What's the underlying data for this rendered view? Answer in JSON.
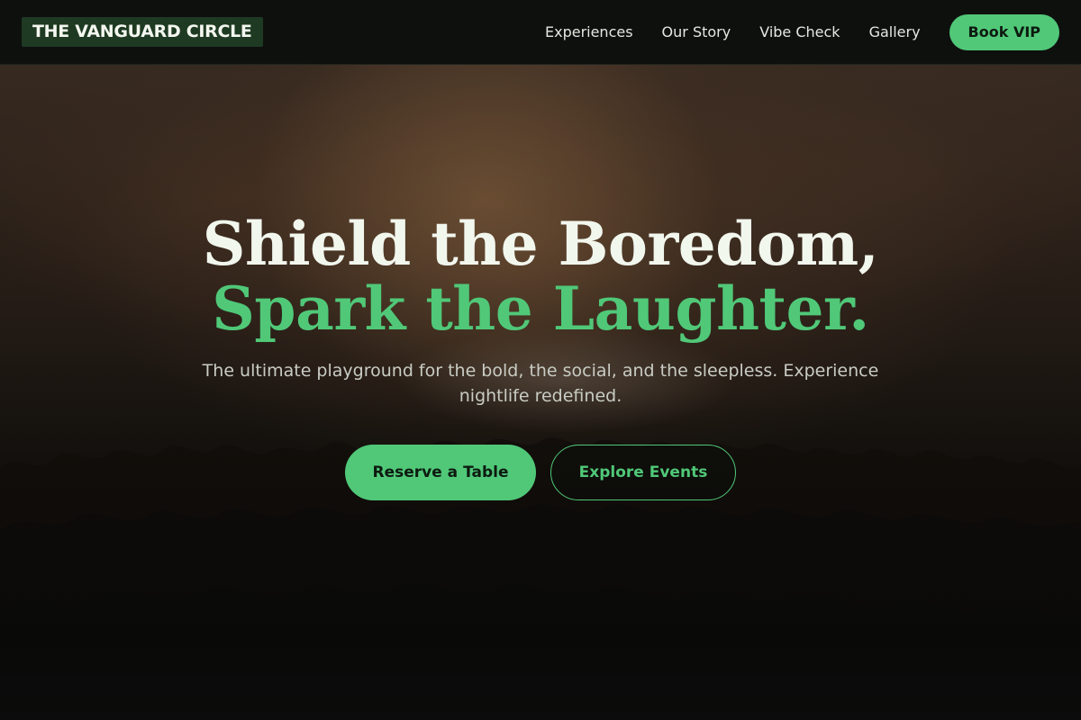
{
  "brand": {
    "logo_text": "THE VANGUARD CIRCLE"
  },
  "nav": {
    "links": [
      "Experiences",
      "Our Story",
      "Vibe Check",
      "Gallery"
    ],
    "cta_label": "Book VIP"
  },
  "hero": {
    "headline_line1": "Shield the Boredom,",
    "headline_line2": "Spark the Laughter.",
    "subtitle": "The ultimate playground for the bold, the social, and the sleepless. Experience nightlife redefined.",
    "primary_cta": "Reserve a Table",
    "secondary_cta": "Explore Events",
    "background_image": "concert-crowd-photo"
  },
  "colors": {
    "accent": "#50c878",
    "background": "#0b0d0b",
    "nav_background": "#0e100e",
    "logo_background": "#1f3a22",
    "text_primary": "#f2f7ee",
    "text_muted": "#c9ccc4"
  }
}
